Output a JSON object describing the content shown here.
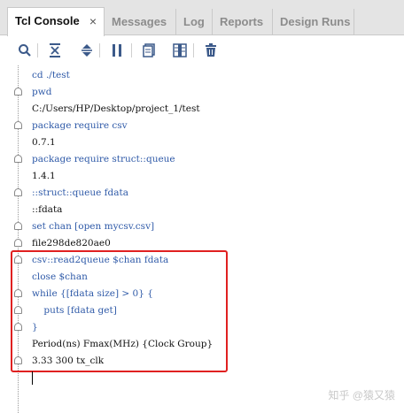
{
  "tabs": [
    {
      "label": "Tcl Console",
      "active": true,
      "close": "×"
    },
    {
      "label": "Messages"
    },
    {
      "label": "Log"
    },
    {
      "label": "Reports"
    },
    {
      "label": "Design Runs"
    }
  ],
  "toolbar": {
    "icons": [
      "search-icon",
      "collapse-all-icon",
      "expand-collapse-icon",
      "pause-icon",
      "copy-icon",
      "columns-icon",
      "delete-icon"
    ]
  },
  "console": {
    "lines": [
      {
        "text": "cd ./test",
        "kind": "cmd"
      },
      {
        "text": "pwd",
        "kind": "cmd"
      },
      {
        "text": "C:/Users/HP/Desktop/project_1/test",
        "kind": "out"
      },
      {
        "text": "package require csv",
        "kind": "cmd"
      },
      {
        "text": "0.7.1",
        "kind": "out"
      },
      {
        "text": "package require struct::queue",
        "kind": "cmd"
      },
      {
        "text": "1.4.1",
        "kind": "out"
      },
      {
        "text": "::struct::queue fdata",
        "kind": "cmd"
      },
      {
        "text": "::fdata",
        "kind": "out"
      },
      {
        "text": "set chan [open mycsv.csv]",
        "kind": "cmd"
      },
      {
        "text": "file298de820ae0",
        "kind": "out"
      },
      {
        "text": "csv::read2queue $chan fdata",
        "kind": "cmd"
      },
      {
        "text": "close $chan",
        "kind": "cmd"
      },
      {
        "text": "while {[fdata size] > 0} {",
        "kind": "cmd"
      },
      {
        "text": "    puts [fdata get]",
        "kind": "cmd"
      },
      {
        "text": "}",
        "kind": "cmd"
      },
      {
        "text": "Period(ns) Fmax(MHz) {Clock Group}",
        "kind": "out"
      },
      {
        "text": "3.33 300 tx_clk",
        "kind": "out"
      }
    ]
  },
  "watermark": "知乎 @猿又猿"
}
